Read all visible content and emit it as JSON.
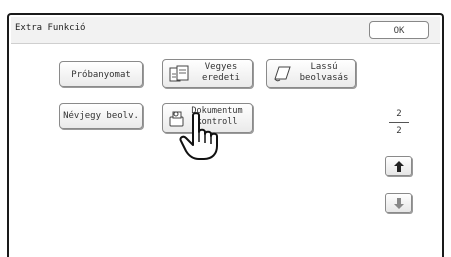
{
  "window": {
    "title": "Extra Funkció"
  },
  "toolbar": {
    "ok_label": "OK"
  },
  "buttons": {
    "proba": "Próbanyomat",
    "vegyes": "Vegyes eredeti",
    "lassu": "Lassú beolvasás",
    "nevjegy": "Névjegy beolv.",
    "dok_line1": "Dokumentum",
    "dok_line2": "kontroll"
  },
  "pager": {
    "current": "2",
    "total": "2"
  },
  "icons": {
    "vegyes": "mixed-originals-icon",
    "lassu": "slow-scan-icon",
    "dok": "document-control-icon",
    "up": "arrow-up-icon",
    "down": "arrow-down-icon",
    "pointer": "pointing-hand-icon"
  },
  "colors": {
    "frame": "#1a1a1a",
    "titlebar": "#f2f2f2",
    "background": "#ffffff"
  }
}
